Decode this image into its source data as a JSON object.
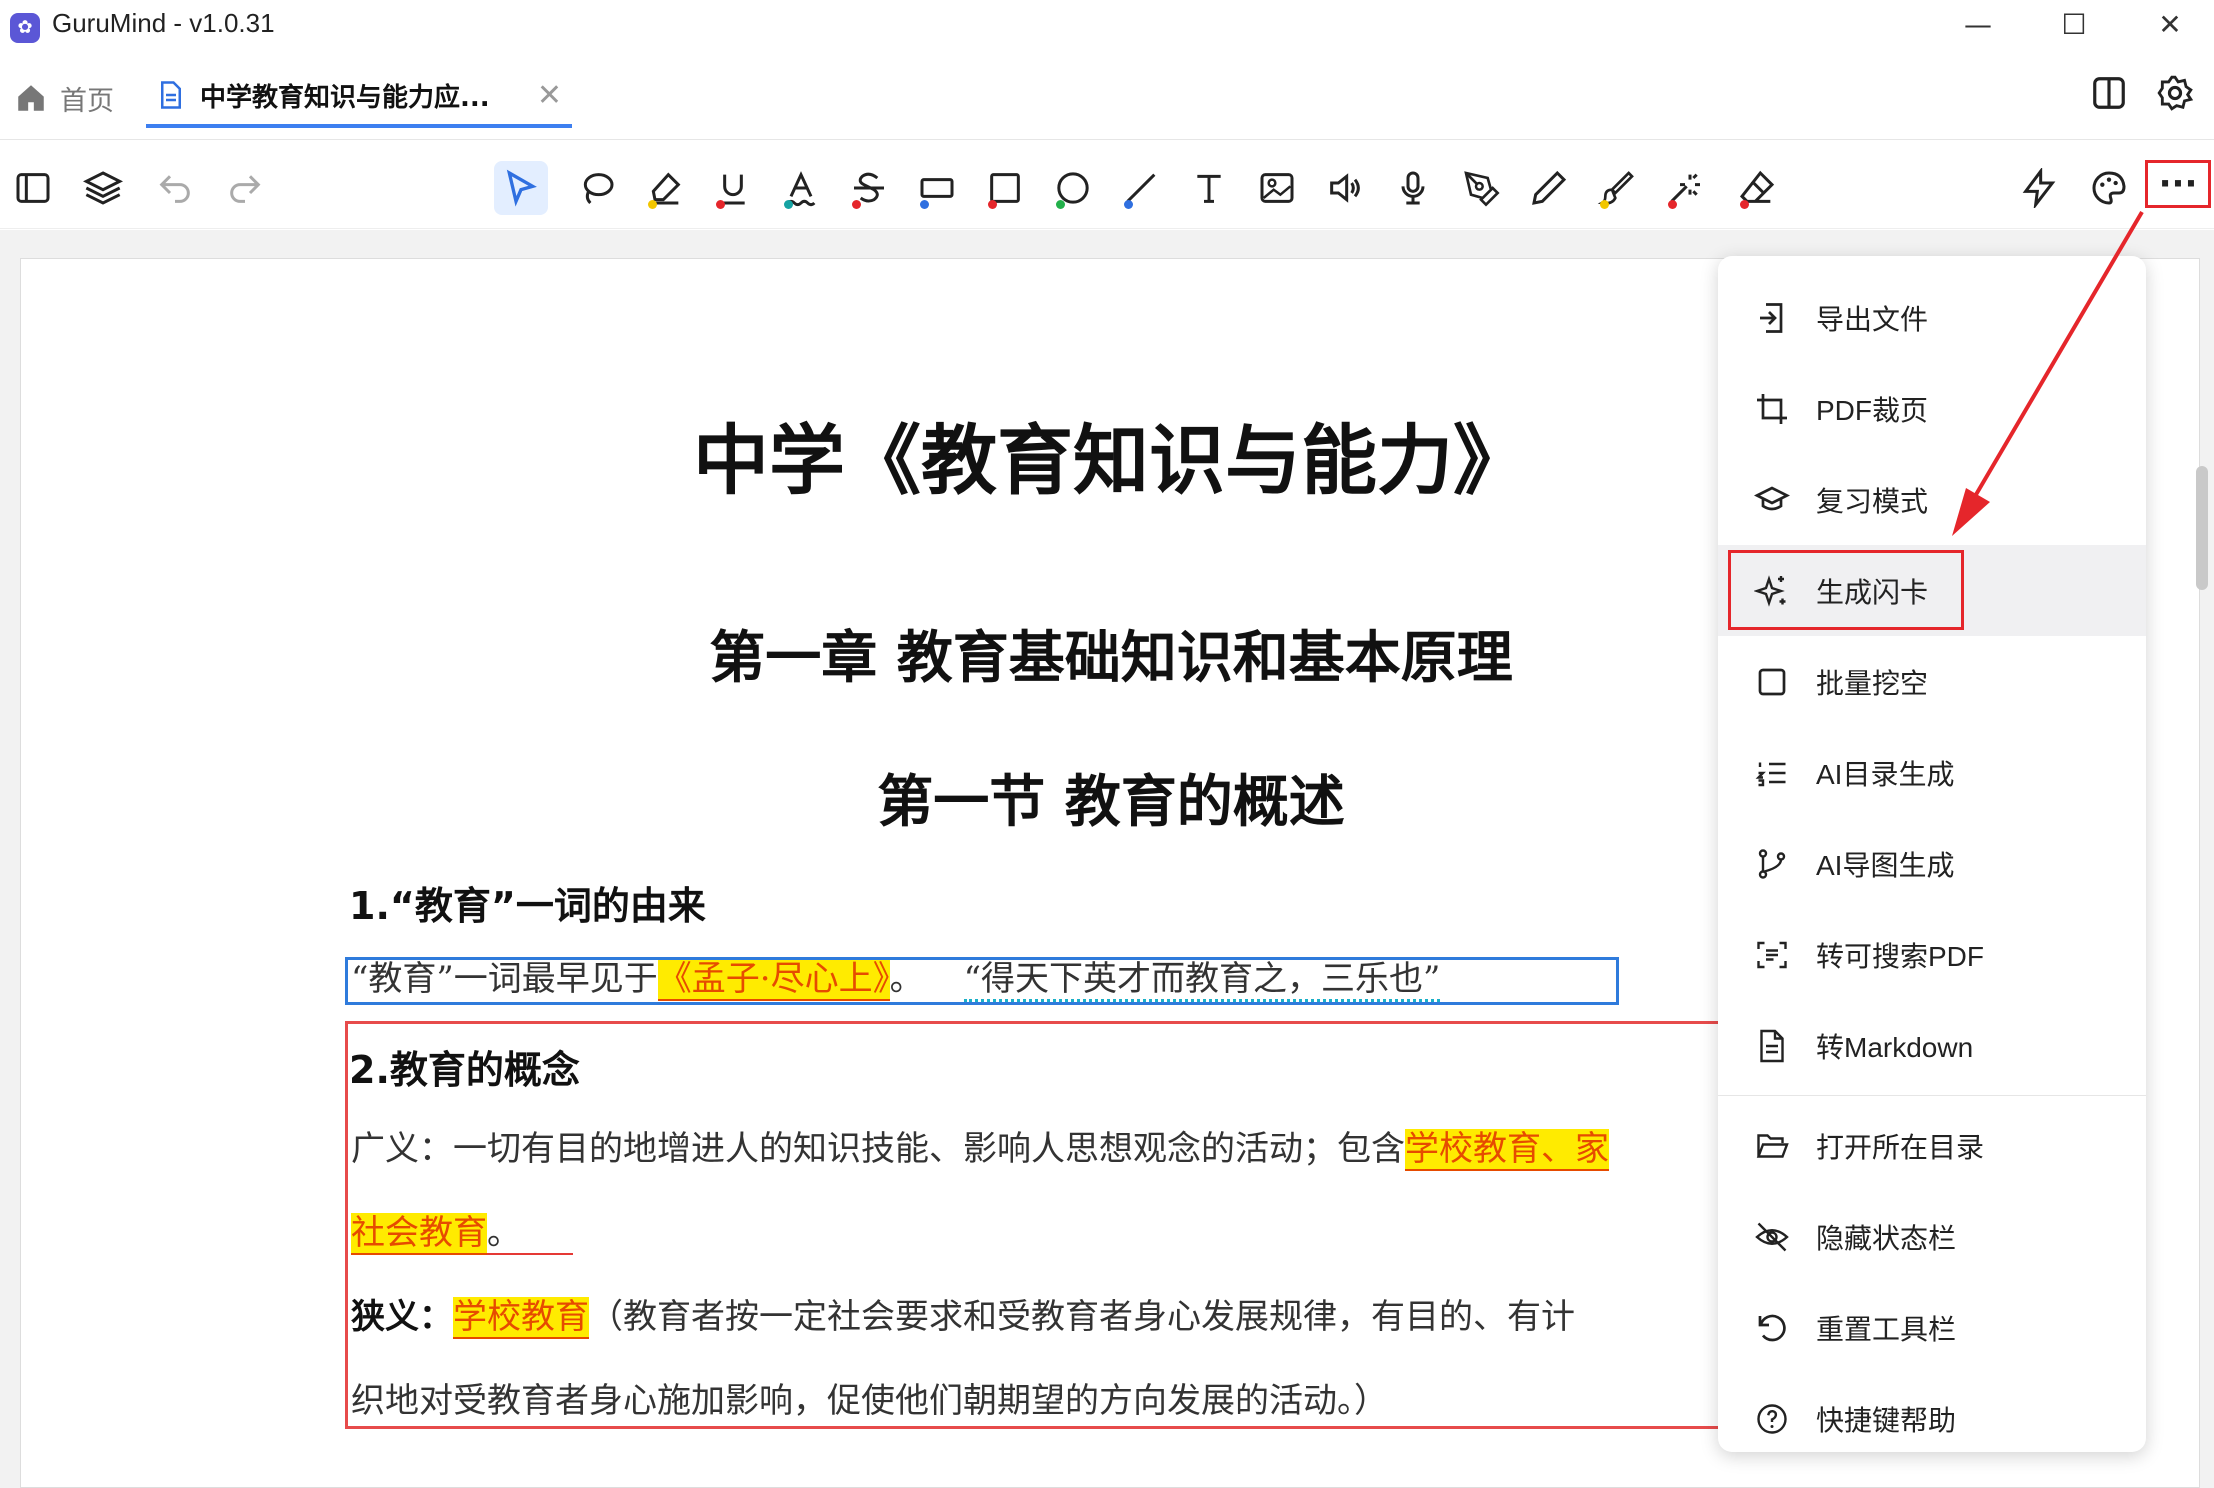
{
  "app": {
    "title": "GuruMind - v1.0.31"
  },
  "tabs": {
    "home_label": "首页",
    "doc_label": "中学教育知识与能力应..."
  },
  "document": {
    "title": "中学《教育知识与能力》",
    "chapter": "第一章  教育基础知识和基本原理",
    "section": "第一节  教育的概述",
    "h1": "1.“教育”一词的由来",
    "p1a": "“教育”一词最早见于",
    "p1b": "《孟子·尽心上》",
    "p1c": "。",
    "p1d": "“得天下英才而教育之，三乐也”",
    "h2": "2.教育的概念",
    "p2a": "广义：一切有目的地增进人的知识技能、影响人思想观念的活动；包含",
    "p2b": "学校教育、家",
    "p2c": "社会教育",
    "p2d": "。",
    "p3a": "狭义：",
    "p3b": "学校教育",
    "p3c": "（教育者按一定社会要求和受教育者身心发展规律，有目的、有计",
    "p4": "织地对受教育者身心施加影响，促使他们朝期望的方向发展的活动。）"
  },
  "menu": {
    "items": [
      {
        "label": "导出文件",
        "icon": "export-icon"
      },
      {
        "label": "PDF裁页",
        "icon": "crop-icon"
      },
      {
        "label": "复习模式",
        "icon": "graduation-cap-icon"
      },
      {
        "label": "生成闪卡",
        "icon": "sparkles-icon"
      },
      {
        "label": "批量挖空",
        "icon": "square-icon"
      },
      {
        "label": "AI目录生成",
        "icon": "list-ordered-icon"
      },
      {
        "label": "AI导图生成",
        "icon": "branch-icon"
      },
      {
        "label": "转可搜索PDF",
        "icon": "scan-text-icon"
      },
      {
        "label": "转Markdown",
        "icon": "file-text-icon"
      },
      {
        "label": "打开所在目录",
        "icon": "folder-open-icon"
      },
      {
        "label": "隐藏状态栏",
        "icon": "eye-off-icon"
      },
      {
        "label": "重置工具栏",
        "icon": "rotate-ccw-icon"
      },
      {
        "label": "快捷键帮助",
        "icon": "help-circle-icon"
      }
    ]
  },
  "colors": {
    "accent": "#3d7ff0",
    "annotation_red": "#e5262b",
    "highlight_yellow": "#ffeb00"
  }
}
